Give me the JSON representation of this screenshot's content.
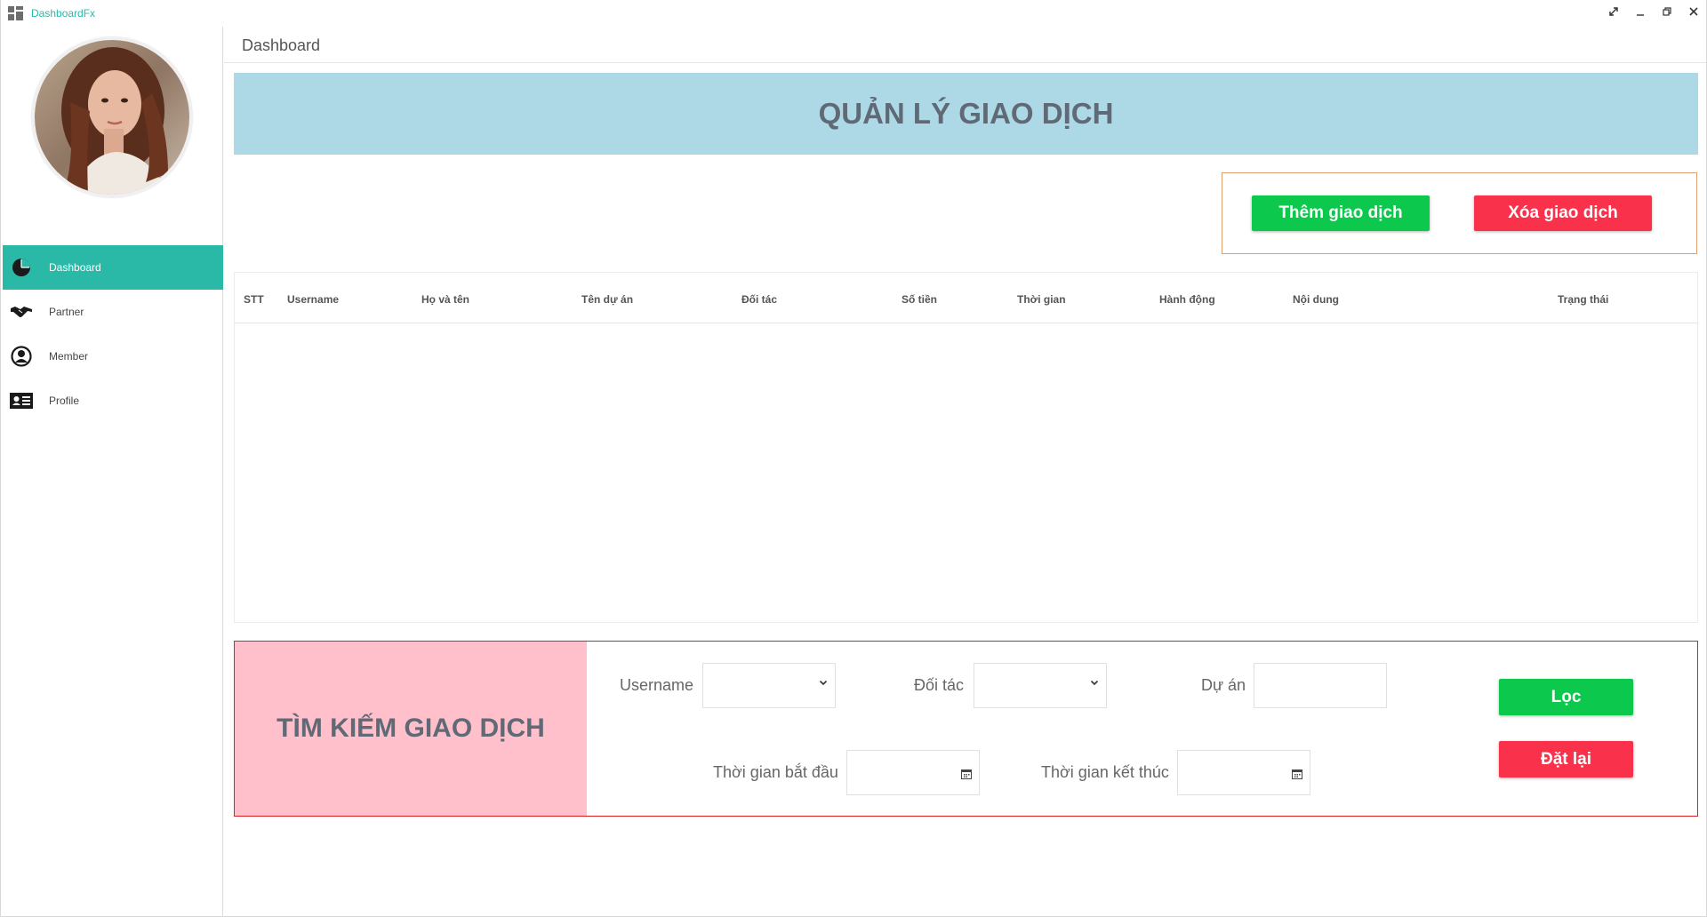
{
  "window": {
    "app_title": "DashboardFx",
    "controls": [
      "expand-icon",
      "minimize-icon",
      "restore-icon",
      "close-icon"
    ]
  },
  "sidebar": {
    "items": [
      {
        "label": "Dashboard",
        "icon": "pie-chart-icon",
        "active": true
      },
      {
        "label": "Partner",
        "icon": "handshake-icon",
        "active": false
      },
      {
        "label": "Member",
        "icon": "user-circle-icon",
        "active": false
      },
      {
        "label": "Profile",
        "icon": "id-card-icon",
        "active": false
      }
    ]
  },
  "header": {
    "title": "Dashboard"
  },
  "banner": {
    "title": "QUẢN LÝ GIAO DỊCH"
  },
  "actions": {
    "add_label": "Thêm giao dịch",
    "delete_label": "Xóa giao dịch"
  },
  "table": {
    "columns": [
      "STT",
      "Username",
      "Họ và tên",
      "Tên dự án",
      "Đối tác",
      "Số tiền",
      "Thời gian",
      "Hành động",
      "Nội dung",
      "Trạng thái"
    ],
    "rows": []
  },
  "search": {
    "title": "TÌM KIẾM GIAO DỊCH",
    "username_label": "Username",
    "username_value": "",
    "partner_label": "Đối tác",
    "partner_value": "",
    "project_label": "Dự án",
    "project_value": "",
    "start_label": "Thời gian bắt đầu",
    "start_value": "",
    "end_label": "Thời gian kết thúc",
    "end_value": "",
    "filter_label": "Lọc",
    "reset_label": "Đặt lại"
  },
  "colors": {
    "accent": "#2bb9a7",
    "banner_bg": "#add8e6",
    "search_bg": "#ffc0cb",
    "green_button": "#0cc84c",
    "red_button": "#f9314a"
  }
}
